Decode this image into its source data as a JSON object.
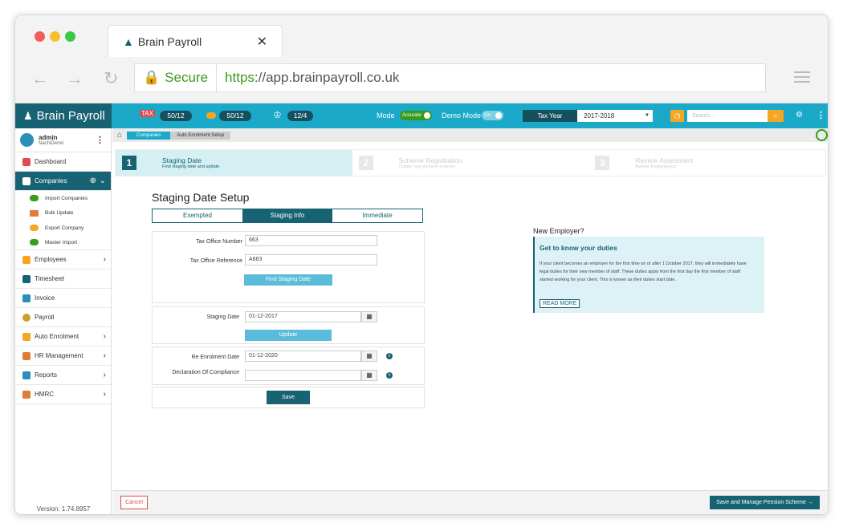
{
  "browser": {
    "tab_title": "Brain Payroll",
    "tab_close": "✕",
    "secure_label": "Secure",
    "url_scheme": "https",
    "url_rest": "://app.brainpayroll.co.uk"
  },
  "topbar": {
    "brand": "Brain Payroll",
    "counter1": "50/12",
    "counter2": "50/12",
    "counter3": "12/4",
    "mode_label": "Mode",
    "mode_toggle": "Accurate",
    "demo_label": "Demo Mode",
    "demo_toggle": "On",
    "tax_year_label": "Tax Year",
    "tax_year_value": "2017-2018",
    "search_placeholder": "Search..."
  },
  "sidebar": {
    "user_name": "admin",
    "user_company": "NachiDemo",
    "items": [
      {
        "label": "Dashboard"
      },
      {
        "label": "Companies"
      },
      {
        "label": "Employees"
      },
      {
        "label": "Timesheet"
      },
      {
        "label": "Invoice"
      },
      {
        "label": "Payroll"
      },
      {
        "label": "Auto Enrolment"
      },
      {
        "label": "HR Management"
      },
      {
        "label": "Reports"
      },
      {
        "label": "HMRC"
      }
    ],
    "subitems": [
      {
        "label": "Import Companies"
      },
      {
        "label": "Bulk Update"
      },
      {
        "label": "Export Company"
      },
      {
        "label": "Master Import"
      }
    ],
    "version": "Version: 1.74.8957"
  },
  "breadcrumb": {
    "b1": "Companies",
    "b2": "Auto Enrolment Setup"
  },
  "steps": [
    {
      "num": "1",
      "title": "Staging Date",
      "desc": "Find staging date and update"
    },
    {
      "num": "2",
      "title": "Scheme Registration",
      "desc": "Create new pension scheme"
    },
    {
      "num": "3",
      "title": "Review Assesment",
      "desc": "Review Employee(s)"
    }
  ],
  "form": {
    "title": "Staging Date Setup",
    "tabs": [
      "Exempted",
      "Staging Info",
      "Immediate"
    ],
    "tax_office_number_label": "Tax Office Number",
    "tax_office_number": "663",
    "tax_office_reference_label": "Tax Office Reference",
    "tax_office_reference": "A663",
    "find_button": "Find Staging Date",
    "staging_date_label": "Staging Date",
    "staging_date": "01-12-2017",
    "update_button": "Update",
    "reenrol_label": "Re Enrolment Date",
    "reenrol_date": "01-12-2020",
    "declaration_label": "Declaration Of Compliance",
    "declaration_date": "",
    "save_button": "Save"
  },
  "info": {
    "heading": "New Employer?",
    "box_title": "Get to know your duties",
    "text": "If your client becomes an employer for the first time on or after 1 October 2017, they will immediately have legal duties for their new member of staff. These duties apply from the first day the first member of staff started working for your client. This is known as their duties start date.",
    "read_more": "READ MORE"
  },
  "footer": {
    "cancel": "Cancel",
    "save_manage": "Save and Manage Pension Scheme →"
  }
}
